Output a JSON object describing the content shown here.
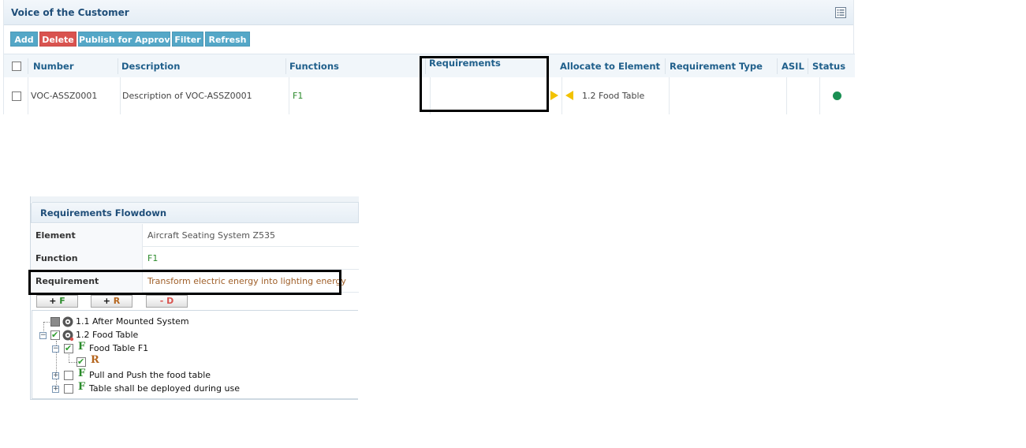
{
  "voc": {
    "title": "Voice of the Customer",
    "toolbar": {
      "add": "Add",
      "delete": "Delete",
      "publish": "Publish for Approval",
      "filter": "Filter",
      "refresh": "Refresh"
    },
    "columns": {
      "number": "Number",
      "description": "Description",
      "functions": "Functions",
      "requirements": "Requirements",
      "allocate": "Allocate to Element",
      "requirement_type": "Requirement Type",
      "asil": "ASIL",
      "status": "Status"
    },
    "row": {
      "number": "VOC-ASSZ0001",
      "description": "Description of VOC-ASSZ0001",
      "functions": "F1",
      "requirements": "",
      "allocate": "1.2 Food Table",
      "requirement_type": "",
      "asil": "",
      "status_color": "#1a8f53"
    }
  },
  "flowdown": {
    "title": "Requirements Flowdown",
    "element_label": "Element",
    "element_value": "Aircraft Seating System Z535",
    "function_label": "Function",
    "function_value": "F1",
    "requirement_label": "Requirement",
    "requirement_value": "Transform electric energy into lighting energy",
    "buttons": {
      "add_f_plus": "+",
      "add_f_letter": "F",
      "add_r_plus": "+",
      "add_r_letter": "R",
      "del_d_minus": "-",
      "del_d_letter": "D"
    },
    "tree": {
      "node1": "1.1 After Mounted System",
      "node2": "1.2 Food Table",
      "node2_child1": "Food Table F1",
      "node2_child1_req": "R",
      "node2_child2": "Pull and Push the food table",
      "node2_child3": "Table shall be deployed during use",
      "f_letter": "F"
    }
  },
  "colors": {
    "accent_blue": "#54a7c7",
    "danger_red": "#d9534f",
    "header_text": "#1f4e79",
    "function_green": "#2b8a2b",
    "requirement_orange": "#a0602a"
  }
}
